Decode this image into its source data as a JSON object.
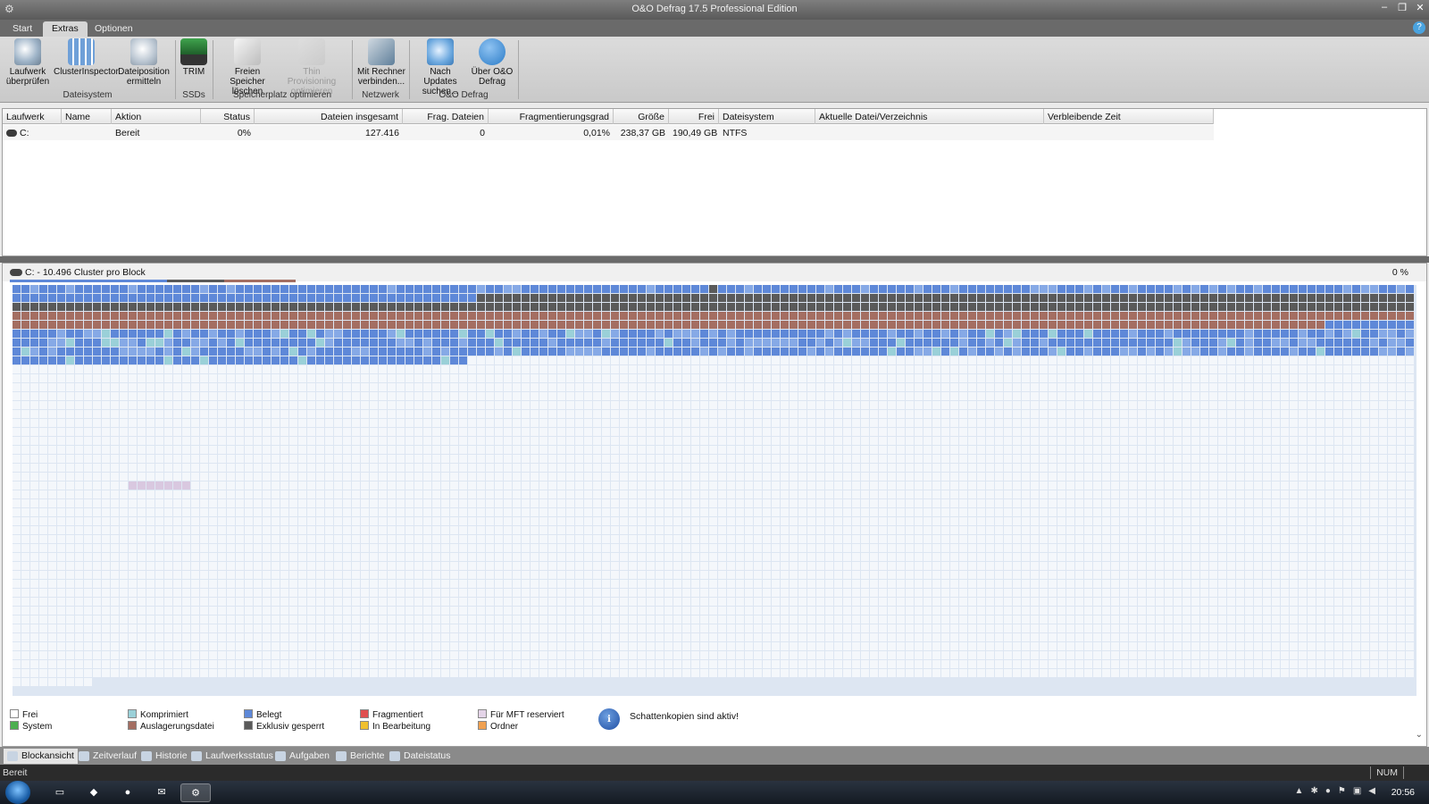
{
  "window": {
    "title": "O&O Defrag 17.5 Professional Edition"
  },
  "ribbon_tabs": [
    "Start",
    "Extras",
    "Optionen"
  ],
  "ribbon": {
    "buttons": [
      {
        "label": "Laufwerk überprüfen",
        "icon": "drive-check-icon",
        "enabled": true
      },
      {
        "label": "ClusterInspector",
        "icon": "cluster-inspector-icon",
        "enabled": true
      },
      {
        "label": "Dateiposition ermitteln",
        "icon": "file-position-icon",
        "enabled": true
      },
      {
        "label": "TRIM",
        "icon": "ssd-trim-icon",
        "enabled": true
      },
      {
        "label": "Freien Speicher löschen",
        "icon": "eraser-icon",
        "enabled": true
      },
      {
        "label": "Thin Provisioning optimieren",
        "icon": "thin-provisioning-icon",
        "enabled": false
      },
      {
        "label": "Mit Rechner verbinden...",
        "icon": "network-connect-icon",
        "enabled": true
      },
      {
        "label": "Nach Updates suchen...",
        "icon": "update-search-icon",
        "enabled": true
      },
      {
        "label": "Über O&O Defrag",
        "icon": "info-icon",
        "enabled": true
      }
    ],
    "groups": [
      "Dateisystem",
      "SSDs",
      "Speicherplatz optimieren",
      "Netzwerk",
      "O&O Defrag"
    ]
  },
  "drive_table": {
    "columns": [
      "Laufwerk",
      "Name",
      "Aktion",
      "Status",
      "Dateien insgesamt",
      "Frag. Dateien",
      "Fragmentierungsgrad",
      "Größe",
      "Frei",
      "Dateisystem",
      "Aktuelle Datei/Verzeichnis",
      "Verbleibende Zeit"
    ],
    "rows": [
      {
        "drive": "C:",
        "name": "",
        "action": "Bereit",
        "status": "0%",
        "files_total": "127.416",
        "frag_files": "0",
        "frag_degree": "0,01%",
        "size": "238,37 GB",
        "free": "190,49 GB",
        "filesystem": "NTFS",
        "current": "",
        "remaining": ""
      }
    ]
  },
  "block_view": {
    "label": "C: - 10.496 Cluster pro Block",
    "percent": "0 %",
    "colors": {
      "free": "#f4f7fb",
      "used": "#5e88d8",
      "used_light": "#86a9e6",
      "exclusive": "#5a5a5a",
      "swap": "#a46e62",
      "compressed": "#9ad0d8",
      "mft": "#d9c8e0"
    }
  },
  "legend": [
    {
      "label": "Frei",
      "color": "#ffffff"
    },
    {
      "label": "System",
      "color": "#4caf50"
    },
    {
      "label": "Komprimiert",
      "color": "#9ad0d8"
    },
    {
      "label": "Auslagerungsdatei",
      "color": "#a46e62"
    },
    {
      "label": "Belegt",
      "color": "#5e88d8"
    },
    {
      "label": "Exklusiv gesperrt",
      "color": "#5a5a5a"
    },
    {
      "label": "Fragmentiert",
      "color": "#e05050"
    },
    {
      "label": "In Bearbeitung",
      "color": "#f0c030"
    },
    {
      "label": "Für MFT reserviert",
      "color": "#e4d4e8"
    },
    {
      "label": "Ordner",
      "color": "#f0a050"
    }
  ],
  "shadow_copies_notice": "Schattenkopien sind aktiv!",
  "view_tabs": [
    "Blockansicht",
    "Zeitverlauf",
    "Historie",
    "Laufwerksstatus",
    "Aufgaben",
    "Berichte",
    "Dateistatus"
  ],
  "statusbar": {
    "status": "Bereit",
    "num": "NUM"
  },
  "taskbar": {
    "clock": "20:56"
  }
}
